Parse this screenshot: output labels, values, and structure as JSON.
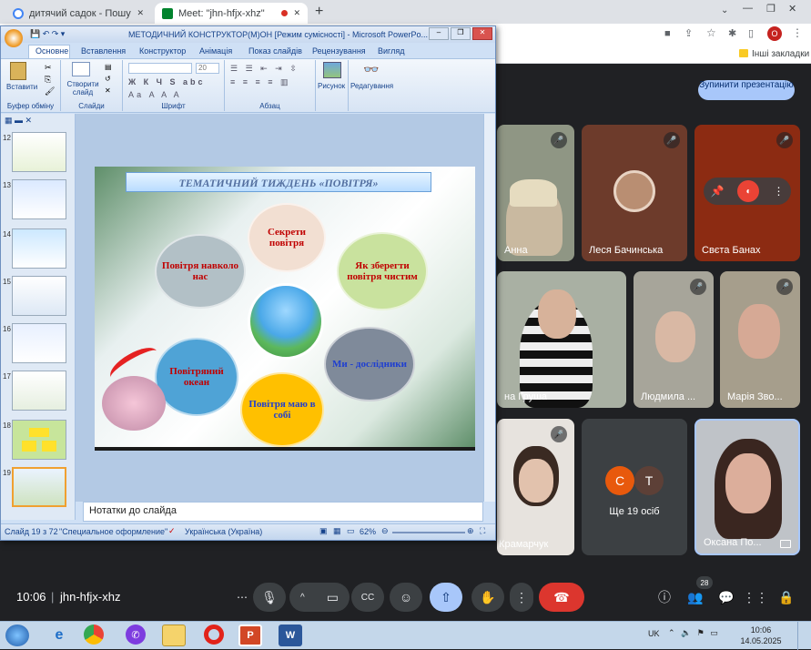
{
  "browser": {
    "tabs": [
      {
        "title": "дитячий садок - Пошук Google",
        "close": "✕"
      },
      {
        "title": "Meet: \"jhn-hfjx-xhz\"",
        "close": "✕"
      }
    ],
    "new_tab": "+",
    "bookmarks_folder": "Інші закладки",
    "profile_letter": "O"
  },
  "ppt": {
    "title": "МЕТОДИЧНИЙ КОНСТРУКТОР(М)ОН [Режим сумісності] - Microsoft PowerPo...",
    "tabs": [
      "Основне",
      "Вставлення",
      "Конструктор",
      "Анімація",
      "Показ слайдів",
      "Рецензування",
      "Вигляд"
    ],
    "groups": {
      "clipboard": "Буфер обміну",
      "slides": "Слайди",
      "font": "Шрифт",
      "paragraph": "Абзац"
    },
    "buttons": {
      "paste": "Вставити",
      "new_slide": "Створити слайд",
      "picture": "Рисунок",
      "editing": "Редагування"
    },
    "font_size": "20",
    "thumb_numbers": [
      "12",
      "13",
      "14",
      "15",
      "16",
      "17",
      "18",
      "19"
    ],
    "slide": {
      "title": "ТЕМАТИЧНИЙ ТИЖДЕНЬ «ПОВІТРЯ»",
      "bubbles": [
        "Секрети повітря",
        "Як зберегти повітря чистим",
        "Ми - дослідники",
        "Повітря маю в собі",
        "Повітряний океан",
        "Повітря навколо нас"
      ]
    },
    "notes": "Нотатки до слайда",
    "status": {
      "slide": "Слайд 19 з 72",
      "theme": "\"Специальное оформление\"",
      "language": "Українська (Україна)",
      "zoom": "62%"
    }
  },
  "meet": {
    "stop_presenting": "Зупинити презентацію",
    "participants": [
      {
        "name": "Анна"
      },
      {
        "name": "Леся Бачинська"
      },
      {
        "name": "Свєта Банах"
      },
      {
        "name": "на Груша"
      },
      {
        "name": "Людмила ..."
      },
      {
        "name": "Марія Зво..."
      },
      {
        "name": "Юля Крамарчук"
      },
      {
        "name": "Ще 19 осіб"
      },
      {
        "name": "Оксана По..."
      }
    ],
    "more_initials": [
      "C",
      "T"
    ],
    "time": "10:06",
    "separator": "|",
    "meeting_code": "jhn-hfjx-xhz",
    "participant_count": "28"
  },
  "taskbar": {
    "lang": "UK",
    "time": "10:06",
    "date": "14.05.2025"
  }
}
